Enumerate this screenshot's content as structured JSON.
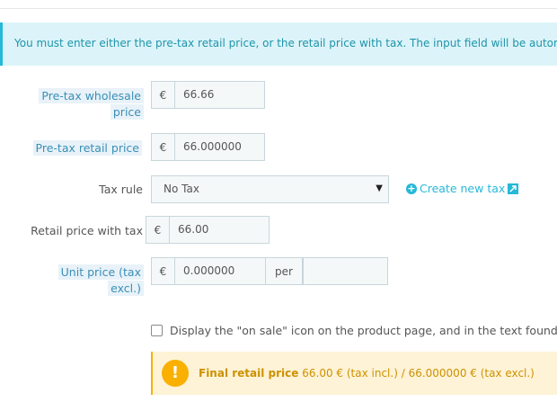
{
  "info_alert": {
    "text": "You must enter either the pre-tax retail price, or the retail price with tax. The input field will be automatically"
  },
  "wholesale": {
    "label_line1": "Pre-tax wholesale",
    "label_line2": "price",
    "currency": "€",
    "value": "66.66"
  },
  "retail_pretax": {
    "label": "Pre-tax retail price",
    "currency": "€",
    "value": "66.000000"
  },
  "tax_rule": {
    "label": "Tax rule",
    "selected": "No Tax",
    "create_link": "Create new tax"
  },
  "retail_with_tax": {
    "label": "Retail price with tax",
    "currency": "€",
    "value": "66.00"
  },
  "unit_price": {
    "label_line1": "Unit price (tax",
    "label_line2": "excl.)",
    "currency": "€",
    "value": "0.000000",
    "per_label": "per",
    "per_value": ""
  },
  "on_sale": {
    "checked": false,
    "label": "Display the \"on sale\" icon on the product page, and in the text found wi"
  },
  "final_price": {
    "icon": "!",
    "title": "Final retail price",
    "detail": "66.00 € (tax incl.) / 66.000000 € (tax excl.)"
  },
  "colors": {
    "accent": "#25b9d7",
    "info_bg": "#dcf4f9",
    "warning": "#fab000",
    "warning_bg": "#fff3d7"
  }
}
